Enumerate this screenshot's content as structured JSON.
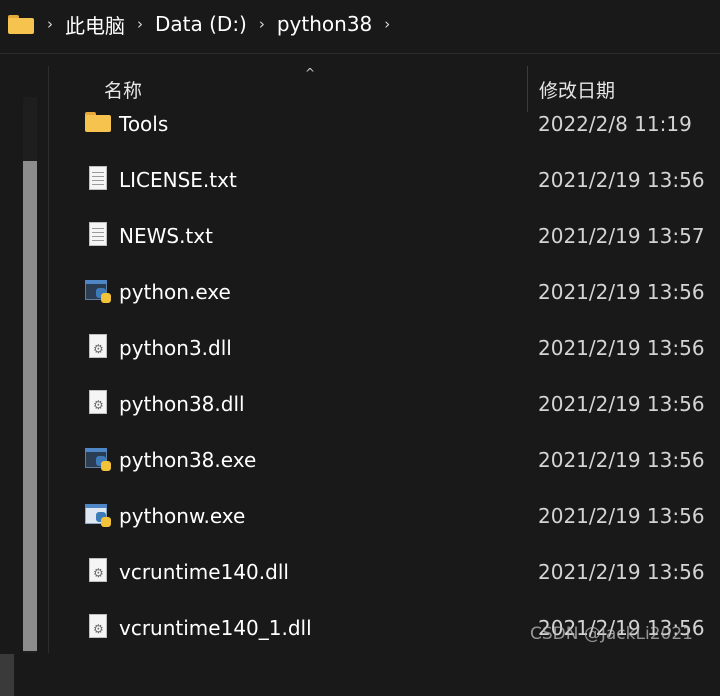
{
  "breadcrumb": {
    "items": [
      "此电脑",
      "Data (D:)",
      "python38"
    ],
    "separator": "›"
  },
  "header": {
    "name_label": "名称",
    "date_label": "修改日期",
    "sort_indicator": "^"
  },
  "files": [
    {
      "name": "Tools",
      "date": "2022/2/8 11:19",
      "icon": "folder-icon"
    },
    {
      "name": "LICENSE.txt",
      "date": "2021/2/19 13:56",
      "icon": "text-file-icon"
    },
    {
      "name": "NEWS.txt",
      "date": "2021/2/19 13:57",
      "icon": "text-file-icon"
    },
    {
      "name": "python.exe",
      "date": "2021/2/19 13:56",
      "icon": "python-exe-icon"
    },
    {
      "name": "python3.dll",
      "date": "2021/2/19 13:56",
      "icon": "dll-file-icon"
    },
    {
      "name": "python38.dll",
      "date": "2021/2/19 13:56",
      "icon": "dll-file-icon"
    },
    {
      "name": "python38.exe",
      "date": "2021/2/19 13:56",
      "icon": "python-exe-icon"
    },
    {
      "name": "pythonw.exe",
      "date": "2021/2/19 13:56",
      "icon": "pythonw-exe-icon"
    },
    {
      "name": "vcruntime140.dll",
      "date": "2021/2/19 13:56",
      "icon": "dll-file-icon"
    },
    {
      "name": "vcruntime140_1.dll",
      "date": "2021/2/19 13:56",
      "icon": "dll-file-icon"
    }
  ],
  "watermark": "CSDN @JackLi2021",
  "colors": {
    "background": "#191919",
    "folder": "#f6c34e",
    "text": "#ffffff",
    "date_text": "#d4d4d4"
  }
}
